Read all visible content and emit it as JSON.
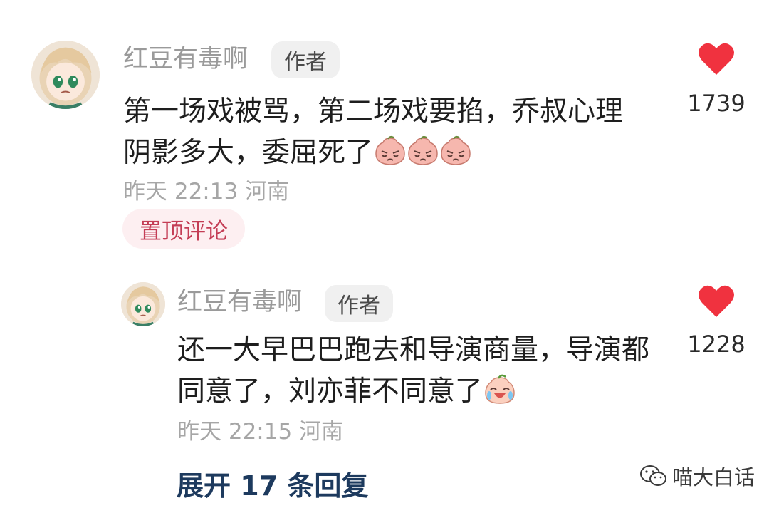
{
  "comments": [
    {
      "username": "红豆有毒啊",
      "badge": "作者",
      "text": "第一场戏被骂，第二场戏要掐，乔叔心理阴影多大，委屈死了",
      "emojis": [
        "sad-face-emoji",
        "sad-face-emoji",
        "sad-face-emoji"
      ],
      "time_location": "昨天 22:13 河南",
      "pinned_label": "置顶评论",
      "likes": "1739"
    }
  ],
  "replies": [
    {
      "username": "红豆有毒啊",
      "badge": "作者",
      "text": "还一大早巴巴跑去和导演商量，导演都同意了，刘亦菲不同意了",
      "emojis": [
        "crying-laugh-emoji"
      ],
      "time_location": "昨天 22:15 河南",
      "likes": "1228"
    }
  ],
  "expand_replies": "展开 17 条回复",
  "watermark": "喵大白话",
  "colors": {
    "like_heart": "#f0323f",
    "pinned_text": "#c43d55",
    "expand_text": "#1d3a5e"
  }
}
